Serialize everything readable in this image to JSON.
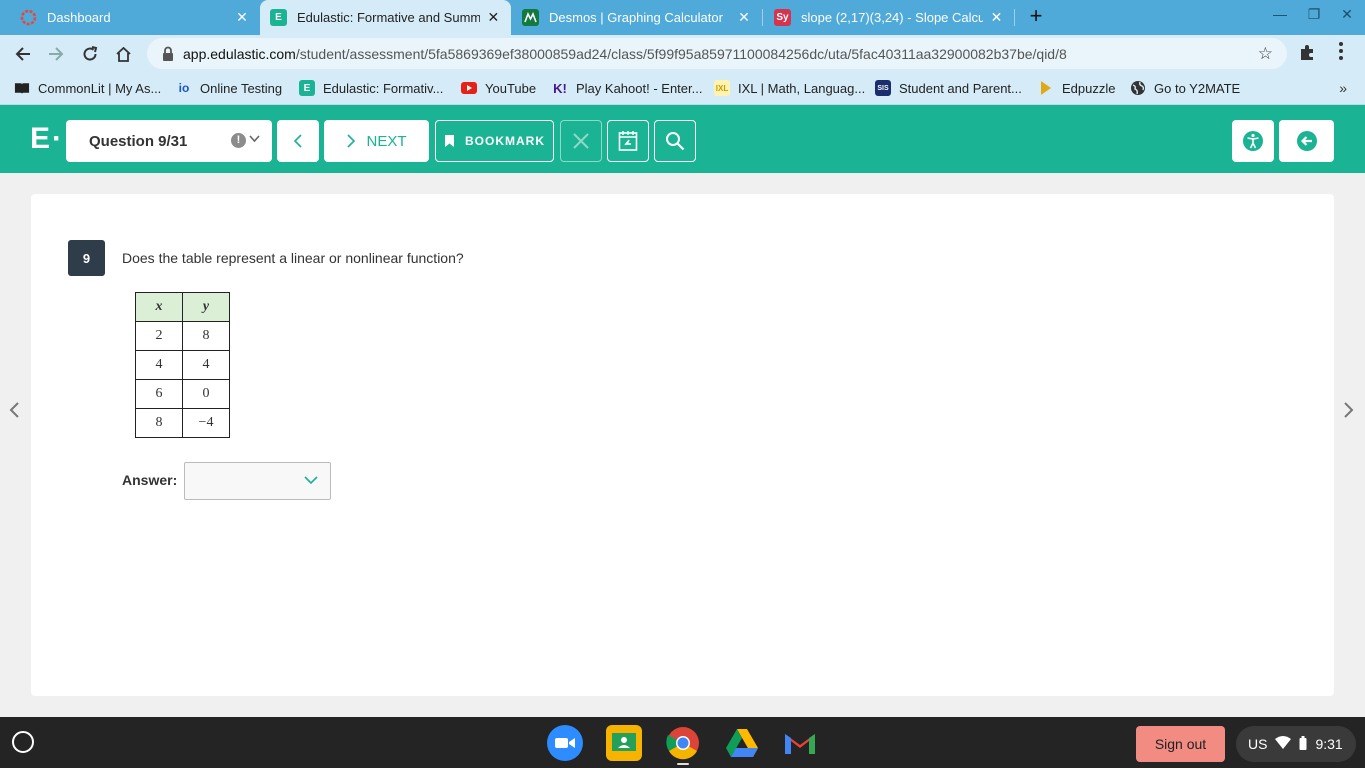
{
  "browser": {
    "tabs": [
      {
        "title": "Dashboard",
        "icon": "dashboard-favicon"
      },
      {
        "title": "Edulastic: Formative and Summa",
        "icon": "edulastic-favicon",
        "active": true
      },
      {
        "title": "Desmos | Graphing Calculator",
        "icon": "desmos-favicon"
      },
      {
        "title": "slope (2,17)(3,24) - Slope Calcula",
        "icon": "symbolab-favicon"
      }
    ],
    "url_host": "app.edulastic.com",
    "url_path": "/student/assessment/5fa5869369ef38000859ad24/class/5f99f95a85971100084256dc/uta/5fac40311aa32900082b37be/qid/8",
    "bookmarks": [
      {
        "label": "CommonLit | My As...",
        "icon": "book-icon"
      },
      {
        "label": "Online Testing",
        "icon": "io-icon"
      },
      {
        "label": "Edulastic: Formativ...",
        "icon": "edulastic-icon"
      },
      {
        "label": "YouTube",
        "icon": "youtube-icon"
      },
      {
        "label": "Play Kahoot! - Enter...",
        "icon": "kahoot-icon"
      },
      {
        "label": "IXL | Math, Languag...",
        "icon": "ixl-icon"
      },
      {
        "label": "Student and Parent...",
        "icon": "sis-icon"
      },
      {
        "label": "Edpuzzle",
        "icon": "edpuzzle-icon"
      },
      {
        "label": "Go to Y2MATE",
        "icon": "globe-icon"
      }
    ],
    "bookmarks_more": "»"
  },
  "edulastic": {
    "logo": "E·",
    "question_select": "Question 9/31",
    "next_label": "NEXT",
    "bookmark_label": "BOOKMARK",
    "accent_color": "#1ab394"
  },
  "question": {
    "number": "9",
    "text": "Does the table represent a linear or nonlinear function?",
    "table": {
      "headers": [
        "x",
        "y"
      ],
      "rows": [
        [
          "2",
          "8"
        ],
        [
          "4",
          "4"
        ],
        [
          "6",
          "0"
        ],
        [
          "8",
          "−4"
        ]
      ]
    },
    "answer_label": "Answer:",
    "answer_value": ""
  },
  "shelf": {
    "signout_label": "Sign out",
    "locale": "US",
    "time": "9:31"
  }
}
